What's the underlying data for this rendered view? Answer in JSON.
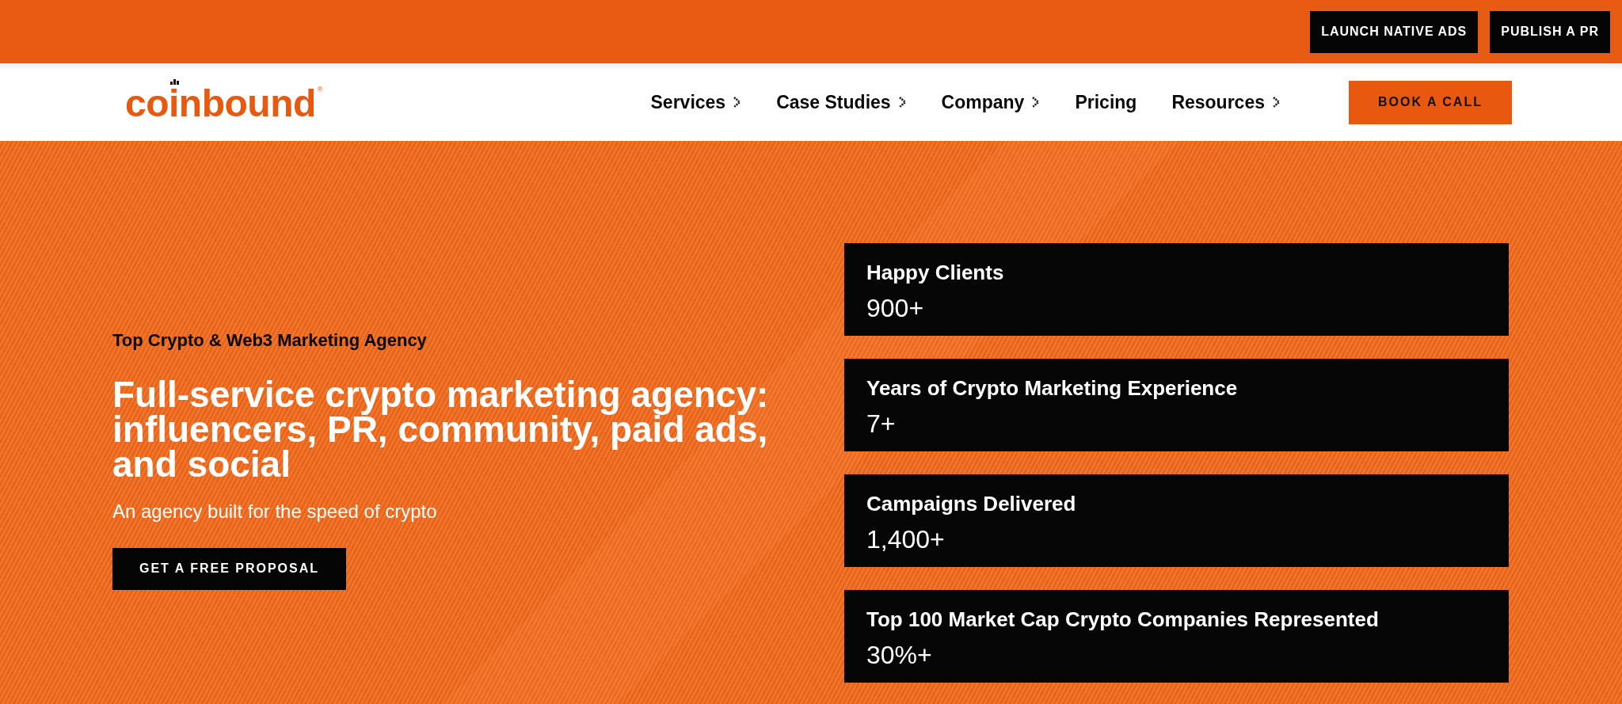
{
  "top_bar": {
    "buttons": [
      "LAUNCH NATIVE ADS",
      "PUBLISH A PR"
    ]
  },
  "header": {
    "logo": {
      "wordmark": "coinbound",
      "registered_mark": "®"
    },
    "nav": [
      {
        "label": "Services",
        "has_submenu": true
      },
      {
        "label": "Case Studies",
        "has_submenu": true
      },
      {
        "label": "Company",
        "has_submenu": true
      },
      {
        "label": "Pricing",
        "has_submenu": false
      },
      {
        "label": "Resources",
        "has_submenu": true
      }
    ],
    "cta": "BOOK A CALL"
  },
  "hero": {
    "eyebrow": "Top Crypto & Web3 Marketing Agency",
    "headline": "Full-service crypto marketing agency: influencers, PR, community, paid ads, and social",
    "subtitle": "An agency built for the speed of crypto",
    "cta": "GET A FREE PROPOSAL"
  },
  "stats": [
    {
      "label": "Happy Clients",
      "value": "900+"
    },
    {
      "label": "Years of Crypto Marketing Experience",
      "value": "7+"
    },
    {
      "label": "Campaigns Delivered",
      "value": "1,400+"
    },
    {
      "label": "Top 100 Market Cap Crypto Companies Represented",
      "value": "30%+"
    }
  ]
}
